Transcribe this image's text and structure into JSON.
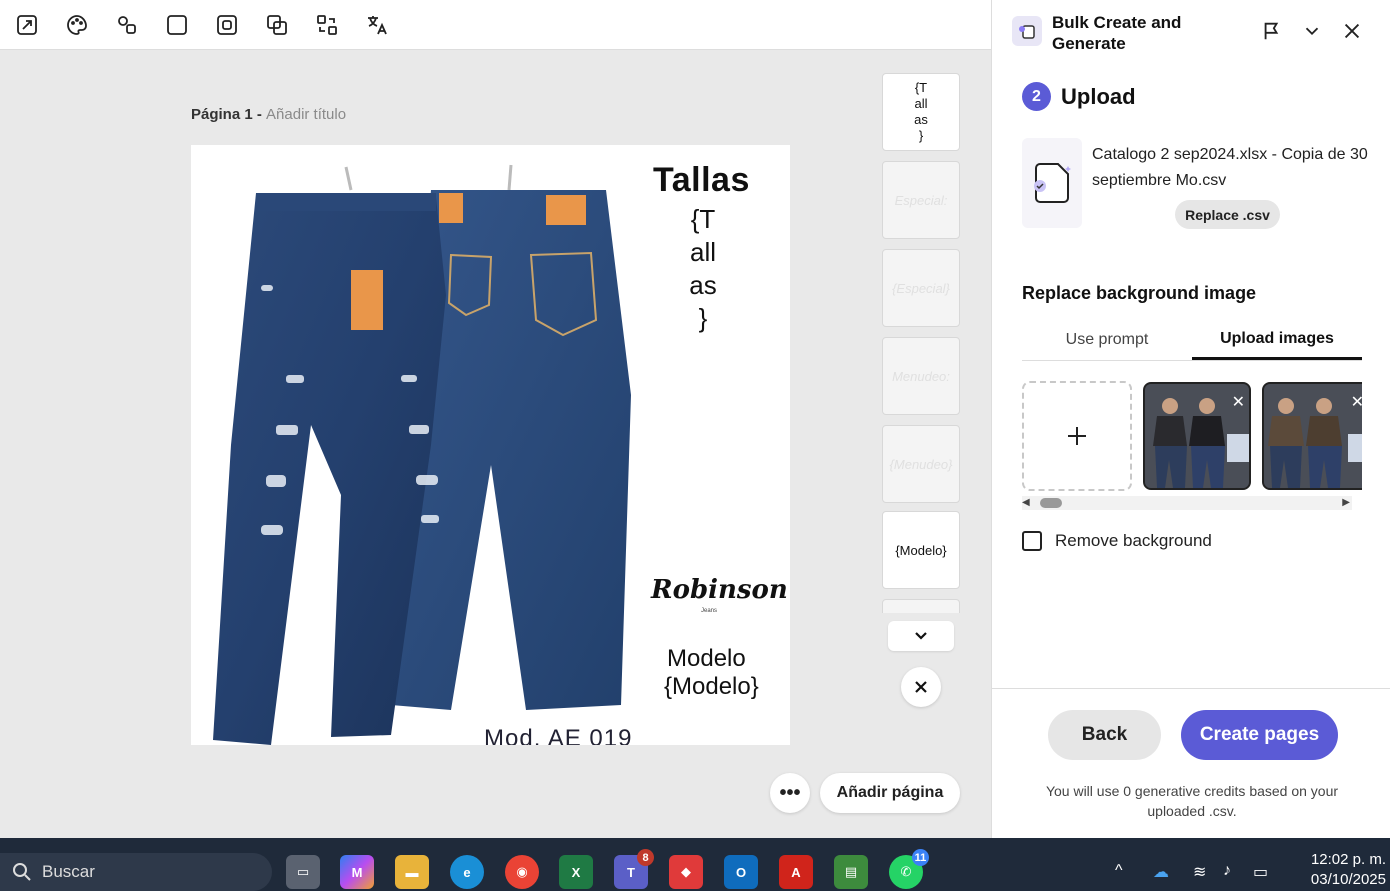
{
  "toolbar": {
    "icons": [
      "resize-icon",
      "palette-icon",
      "shapes-icon",
      "square-icon",
      "frame-icon",
      "layers-icon",
      "swap-icon",
      "translate-icon"
    ]
  },
  "page": {
    "title": "Página 1 - ",
    "add_title": "Añadir título"
  },
  "artboard": {
    "tallas_heading": "Tallas",
    "tallas_placeholder": "{T\nall\nas\n}",
    "brand": "Robinson",
    "brand_sub": "Jeans",
    "modelo_label": "Modelo",
    "modelo_value": "{Modelo}",
    "mod_bottom": "Mod. AE 019"
  },
  "thumbnails": [
    {
      "text": "{T\nall\nas\n}",
      "style": "white"
    },
    {
      "text": "Especial:",
      "style": "grey"
    },
    {
      "text": "{Especial}",
      "style": "grey"
    },
    {
      "text": "Menudeo:",
      "style": "grey"
    },
    {
      "text": "{Menudeo}",
      "style": "grey"
    },
    {
      "text": "{Modelo}",
      "style": "white"
    }
  ],
  "canvas_actions": {
    "add_page": "Añadir página"
  },
  "panel": {
    "title": "Bulk Create and Generate",
    "step_number": "2",
    "step_label": "Upload",
    "file_name": "Catalogo 2 sep2024.xlsx - Copia de 30 septiembre Mo.csv",
    "replace_label": "Replace .csv",
    "section_title": "Replace background image",
    "tabs": [
      {
        "label": "Use prompt",
        "active": false
      },
      {
        "label": "Upload images",
        "active": true
      }
    ],
    "remove_bg_label": "Remove background",
    "back_label": "Back",
    "create_label": "Create pages",
    "credits_text": "You will use 0 generative credits based on your uploaded .csv."
  },
  "taskbar": {
    "search_label": "Buscar",
    "teams_badge": "8",
    "whatsapp_badge": "11",
    "time": "12:02 p. m.",
    "date": "03/10/2025"
  },
  "colors": {
    "accent": "#5b5bd6",
    "taskbar": "#1f2a3a",
    "canvas_bg": "#e9e9e9"
  }
}
